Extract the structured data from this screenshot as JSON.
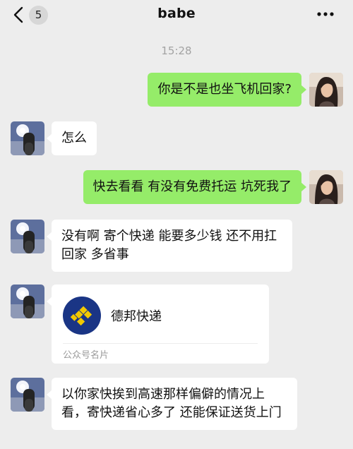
{
  "header": {
    "back_icon": "chevron-left-icon",
    "unread_count": "5",
    "title": "babe",
    "more_icon": "more-dots-icon"
  },
  "timestamp": "15:28",
  "messages": [
    {
      "side": "out",
      "text": "你是不是也坐飞机回家?"
    },
    {
      "side": "in",
      "text": "怎么"
    },
    {
      "side": "out",
      "text": "快去看看 有没有免费托运 坑死我了"
    },
    {
      "side": "in",
      "text": "没有啊 寄个快递 能要多少钱 还不用扛回家 多省事"
    },
    {
      "side": "in",
      "type": "contact-card",
      "name": "德邦快递",
      "card_type": "公众号名片"
    },
    {
      "side": "in",
      "text": "以你家快挨到高速那样偏僻的情况上看，寄快递省心多了 还能保证送货上门"
    }
  ],
  "colors": {
    "background": "#ededed",
    "outgoing_bubble": "#95ec69",
    "incoming_bubble": "#ffffff",
    "card_logo_bg": "#1a3585",
    "card_logo_mark": "#f2c900"
  }
}
